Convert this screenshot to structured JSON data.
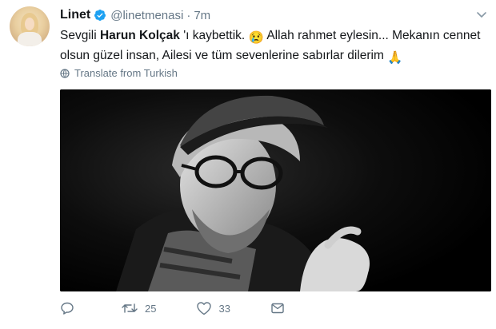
{
  "user": {
    "name": "Linet",
    "handle": "@linetmenasi",
    "separator": "·",
    "time": "7m"
  },
  "tweet": {
    "text_part1": "Sevgili ",
    "mention_name": "Harun Kolçak",
    "text_part2": " 'ı kaybettik. ",
    "emoji1": "😢",
    "text_part3": " Allah rahmet eylesin... Mekanın cennet olsun güzel insan, Ailesi ve tüm sevenlerine sabırlar dilerim ",
    "emoji2": "🙏"
  },
  "translate_label": "Translate from Turkish",
  "actions": {
    "reply_count": "",
    "retweet_count": "25",
    "like_count": "33"
  },
  "icons": [
    "verified-icon",
    "caret-down-icon",
    "globe-icon",
    "reply-icon",
    "retweet-icon",
    "like-icon",
    "dm-icon"
  ],
  "colors": {
    "verified": "#1da1f2",
    "muted": "#657786",
    "text": "#14171a"
  }
}
